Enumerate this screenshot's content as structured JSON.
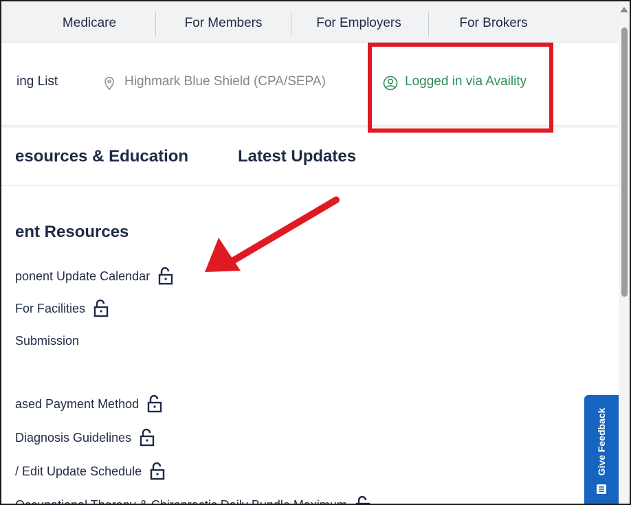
{
  "topnav": {
    "items": [
      {
        "label": "Medicare"
      },
      {
        "label": "For Members"
      },
      {
        "label": "For Employers"
      },
      {
        "label": "For Brokers"
      }
    ]
  },
  "subbar": {
    "list_label": "ing List",
    "location_icon": "map-pin-icon",
    "location": "Highmark Blue Shield (CPA/SEPA)",
    "login_icon": "user-circle-icon",
    "login_status": "Logged in via Availity",
    "login_color": "#2e8b57"
  },
  "tabs": [
    {
      "label": "esources & Education"
    },
    {
      "label": "Latest Updates"
    }
  ],
  "resources": {
    "title": "ent Resources",
    "items": [
      {
        "label": "ponent Update Calendar",
        "locked_icon": "unlock-icon"
      },
      {
        "label": "For Facilities",
        "locked_icon": "unlock-icon"
      },
      {
        "label": "Submission"
      },
      {
        "label": "ased Payment Method",
        "locked_icon": "unlock-icon"
      },
      {
        "label": "Diagnosis Guidelines",
        "locked_icon": "unlock-icon"
      },
      {
        "label": "/ Edit Update Schedule",
        "locked_icon": "unlock-icon"
      },
      {
        "label": "Occupational Therapy & Chiropractic Daily Bundle Maximum",
        "locked_icon": "unlock-icon"
      }
    ]
  },
  "feedback": {
    "label": "Give Feedback",
    "color": "#1565c0"
  },
  "annotation": {
    "box_color": "#e01a22",
    "arrow_color": "#e01a22"
  }
}
